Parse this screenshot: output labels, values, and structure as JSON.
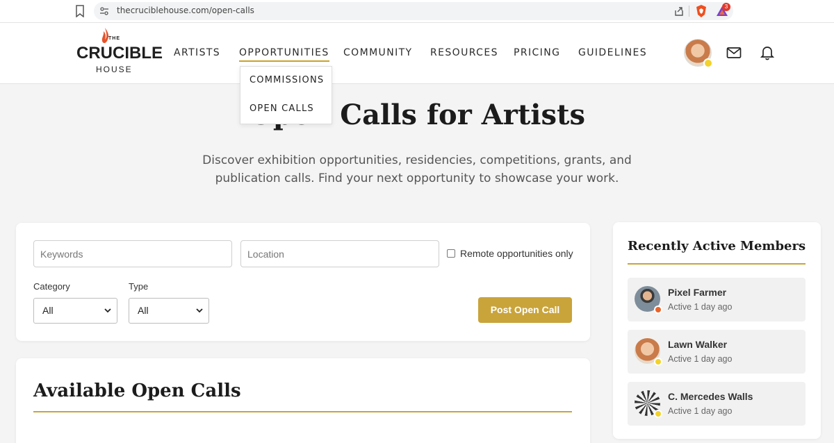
{
  "browser": {
    "url": "thecruciblehouse.com/open-calls",
    "rewards_badge": "3"
  },
  "logo": {
    "the": "THE",
    "main": "CRUCIBLE",
    "house": "HOUSE"
  },
  "nav": {
    "items": [
      "ARTISTS",
      "OPPORTUNITIES",
      "COMMUNITY",
      "RESOURCES",
      "PRICING",
      "GUIDELINES"
    ],
    "active": "OPPORTUNITIES"
  },
  "dropdown": {
    "items": [
      "COMMISSIONS",
      "OPEN CALLS"
    ]
  },
  "hero": {
    "title": "Open Calls for Artists",
    "subtitle": "Discover exhibition opportunities, residencies, competitions, grants, and publication calls. Find your next opportunity to showcase your work."
  },
  "filters": {
    "keywords_placeholder": "Keywords",
    "location_placeholder": "Location",
    "remote_label": "Remote opportunities only",
    "category_label": "Category",
    "category_value": "All",
    "type_label": "Type",
    "type_value": "All",
    "post_button": "Post Open Call"
  },
  "available": {
    "title": "Available Open Calls"
  },
  "members": {
    "title": "Recently Active Members",
    "items": [
      {
        "name": "Pixel Farmer",
        "time": "Active 1 day ago",
        "status_color": "#e8632b"
      },
      {
        "name": "Lawn Walker",
        "time": "Active 1 day ago",
        "status_color": "#f2d22b"
      },
      {
        "name": "C. Mercedes Walls",
        "time": "Active 1 day ago",
        "status_color": "#f2d22b"
      }
    ]
  },
  "colors": {
    "accent": "#c9a43b",
    "background": "#f4f4f4"
  }
}
